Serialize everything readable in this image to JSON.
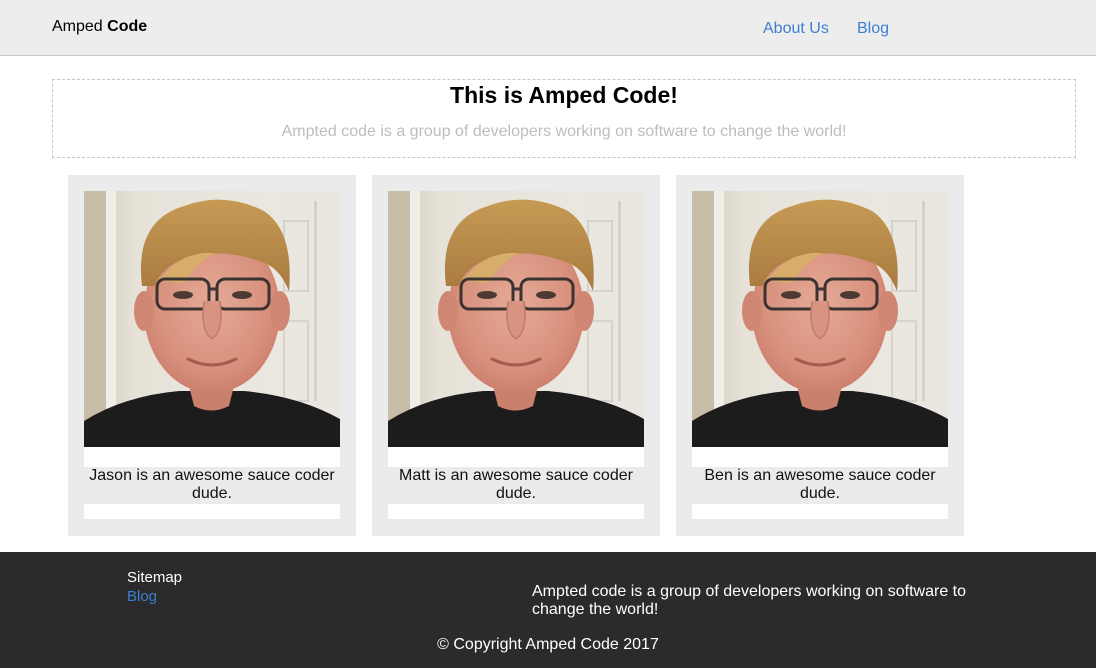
{
  "header": {
    "brand_light": "Amped ",
    "brand_bold": "Code",
    "nav": [
      "About Us",
      "Blog"
    ]
  },
  "hero": {
    "title": "This is Amped Code!",
    "subtitle": "Ampted code is a group of developers working on software to change the world!"
  },
  "team": [
    {
      "caption": "Jason is an awesome sauce coder dude."
    },
    {
      "caption": "Matt is an awesome sauce coder dude."
    },
    {
      "caption": "Ben is an awesome sauce coder dude."
    }
  ],
  "footer": {
    "sitemap_label": "Sitemap",
    "blog_link": "Blog",
    "about": "Ampted code is a group of developers working on software to change the world!",
    "copyright": "© Copyright Amped Code 2017"
  },
  "colors": {
    "header_bg": "#ededed",
    "link": "#3d7fd0",
    "footer_bg": "#2b2b2b",
    "card_bg": "#ebebeb"
  }
}
